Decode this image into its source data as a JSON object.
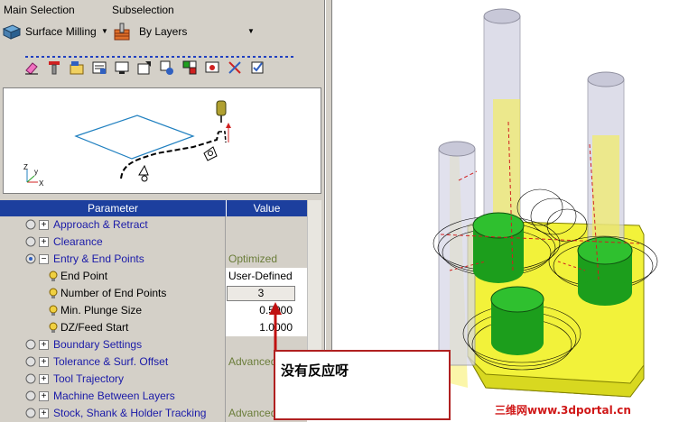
{
  "main_selection": {
    "label": "Main Selection",
    "value": "Surface Milling"
  },
  "subselection": {
    "label": "Subselection",
    "value": "By Layers"
  },
  "toolbar_icons": [
    "eraser-icon",
    "tool-icon",
    "folder-icon",
    "db-icon",
    "monitor-icon",
    "export-icon",
    "tree-icon",
    "layers-icon",
    "link-icon",
    "settings-icon",
    "check-icon"
  ],
  "preview_axes": {
    "z": "Z",
    "y": "y",
    "x": "X"
  },
  "grid": {
    "header_param": "Parameter",
    "header_value": "Value",
    "rows": [
      {
        "label": "Approach & Retract",
        "value": ""
      },
      {
        "label": "Clearance",
        "value": ""
      },
      {
        "label": "Entry & End Points",
        "value": "Optimized"
      },
      {
        "label": "End Point",
        "value": "User-Defined"
      },
      {
        "label": "Number of End Points",
        "value": "3"
      },
      {
        "label": "Min. Plunge Size",
        "value": "0.5000"
      },
      {
        "label": "DZ/Feed Start",
        "value": "1.0000"
      },
      {
        "label": "Boundary Settings",
        "value": ""
      },
      {
        "label": "Tolerance & Surf. Offset",
        "value": "Advanced"
      },
      {
        "label": "Tool Trajectory",
        "value": ""
      },
      {
        "label": "Machine Between Layers",
        "value": ""
      },
      {
        "label": "Stock, Shank & Holder Tracking",
        "value": "Advanced"
      }
    ]
  },
  "callout_text": "没有反应呀",
  "watermark": "三维网www.3dportal.cn",
  "colors": {
    "header": "#1c3f9e",
    "accent_blue": "#1a1aa8",
    "callout_border": "#b02020",
    "part_yellow": "#f2f23a",
    "boss_green": "#1c9e1c"
  }
}
